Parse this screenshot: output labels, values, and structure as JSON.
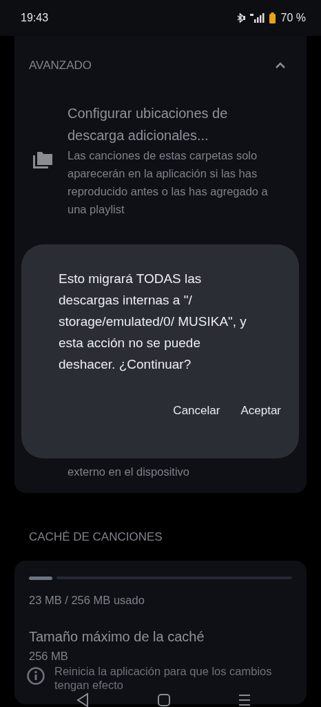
{
  "status_bar": {
    "time": "19:43",
    "battery": "70 %"
  },
  "sections": [
    {
      "title": "AVANZADO",
      "expanded": true,
      "items": [
        {
          "kind": "folder",
          "title": "Configurar ubicaciones de descarga adicionales...",
          "description": "Las canciones de estas carpetas solo aparecerán en la aplicación si las has reproducido antes o las has agregado a una playlist"
        },
        {
          "kind": "covered",
          "description": "externo en el dispositivo"
        }
      ]
    },
    {
      "title": "CACHÉ DE CANCIONES",
      "items": [
        {
          "kind": "meter",
          "level": 0.09,
          "description": "23 MB / 256 MB usado"
        },
        {
          "kind": "setting",
          "title": "Tamaño máximo de la caché",
          "description": "256 MB"
        },
        {
          "kind": "info",
          "description": "Reinicia la aplicación para que los cambios tengan efecto"
        }
      ]
    }
  ],
  "dialog": {
    "message": "Esto migrará TODAS las descargas internas a \"/ storage/emulated/0/ MUSIKA\", y esta acción no se puede deshacer. ¿Continuar?",
    "buttons": [
      "Cancelar",
      "Aceptar"
    ]
  }
}
